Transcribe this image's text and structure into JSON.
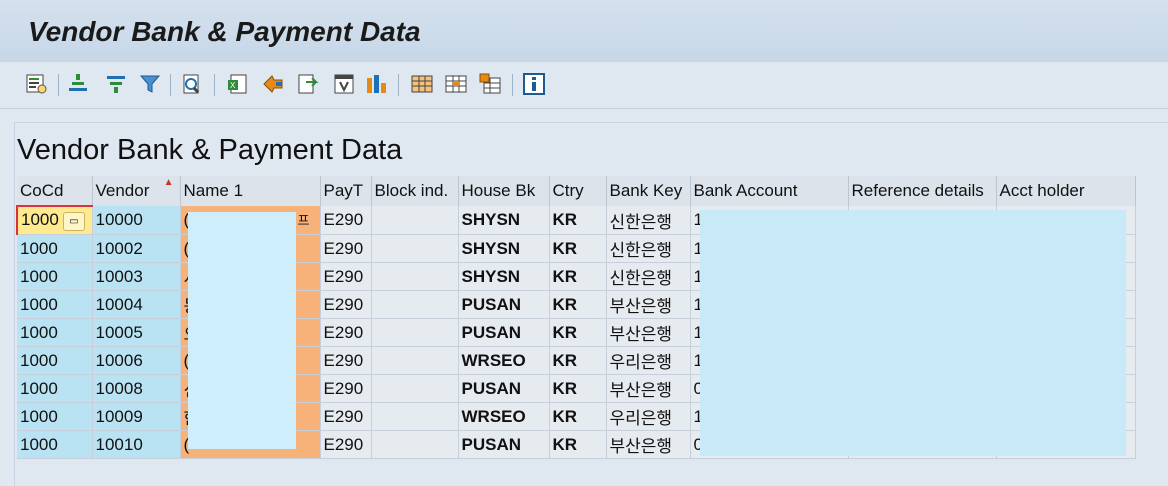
{
  "window": {
    "title": "Vendor Bank & Payment Data"
  },
  "toolbar": {
    "buttons": [
      {
        "name": "details-icon"
      },
      {
        "name": "sort-ascending-icon"
      },
      {
        "name": "sort-descending-icon"
      },
      {
        "name": "filter-icon"
      },
      {
        "name": "print-preview-icon"
      },
      {
        "name": "spreadsheet-icon"
      },
      {
        "name": "word-processing-icon"
      },
      {
        "name": "local-file-icon"
      },
      {
        "name": "abc-analysis-icon"
      },
      {
        "name": "graphic-icon"
      },
      {
        "name": "change-layout-icon"
      },
      {
        "name": "select-layout-icon"
      },
      {
        "name": "save-layout-icon"
      },
      {
        "name": "information-icon"
      }
    ],
    "colors": {
      "accent": "#1f6fb5",
      "orange": "#e58a16",
      "green": "#2f8a3a"
    }
  },
  "report": {
    "title": "Vendor Bank & Payment Data"
  },
  "table": {
    "columns": [
      "CoCd",
      "Vendor",
      "Name 1",
      "PayT",
      "Block ind.",
      "House Bk",
      "Ctry",
      "Bank Key",
      "Bank Account",
      "Reference details",
      "Acct holder"
    ],
    "rows": [
      {
        "cocd": "1000",
        "vendor": "10000",
        "name": "(",
        "name_end": "프",
        "payt": "E290",
        "block": "",
        "house": "SHYSN",
        "ctry": "KR",
        "bankkey": "신한은행",
        "acct": "1"
      },
      {
        "cocd": "1000",
        "vendor": "10002",
        "name": "(",
        "name_end": "",
        "payt": "E290",
        "block": "",
        "house": "SHYSN",
        "ctry": "KR",
        "bankkey": "신한은행",
        "acct": "1"
      },
      {
        "cocd": "1000",
        "vendor": "10003",
        "name": "서",
        "name_end": "",
        "payt": "E290",
        "block": "",
        "house": "SHYSN",
        "ctry": "KR",
        "bankkey": "신한은행",
        "acct": "1"
      },
      {
        "cocd": "1000",
        "vendor": "10004",
        "name": "동",
        "name_end": "",
        "payt": "E290",
        "block": "",
        "house": "PUSAN",
        "ctry": "KR",
        "bankkey": "부산은행",
        "acct": "1"
      },
      {
        "cocd": "1000",
        "vendor": "10005",
        "name": "오",
        "name_end": "",
        "payt": "E290",
        "block": "",
        "house": "PUSAN",
        "ctry": "KR",
        "bankkey": "부산은행",
        "acct": "1"
      },
      {
        "cocd": "1000",
        "vendor": "10006",
        "name": "(",
        "name_end": "",
        "payt": "E290",
        "block": "",
        "house": "WRSEO",
        "ctry": "KR",
        "bankkey": "우리은행",
        "acct": "1"
      },
      {
        "cocd": "1000",
        "vendor": "10008",
        "name": "신",
        "name_end": "",
        "payt": "E290",
        "block": "",
        "house": "PUSAN",
        "ctry": "KR",
        "bankkey": "부산은행",
        "acct": "0"
      },
      {
        "cocd": "1000",
        "vendor": "10009",
        "name": "한",
        "name_end": "",
        "payt": "E290",
        "block": "",
        "house": "WRSEO",
        "ctry": "KR",
        "bankkey": "우리은행",
        "acct": "1"
      },
      {
        "cocd": "1000",
        "vendor": "10010",
        "name": "(",
        "name_end": "",
        "payt": "E290",
        "block": "",
        "house": "PUSAN",
        "ctry": "KR",
        "bankkey": "부산은행",
        "acct": "0"
      }
    ]
  }
}
